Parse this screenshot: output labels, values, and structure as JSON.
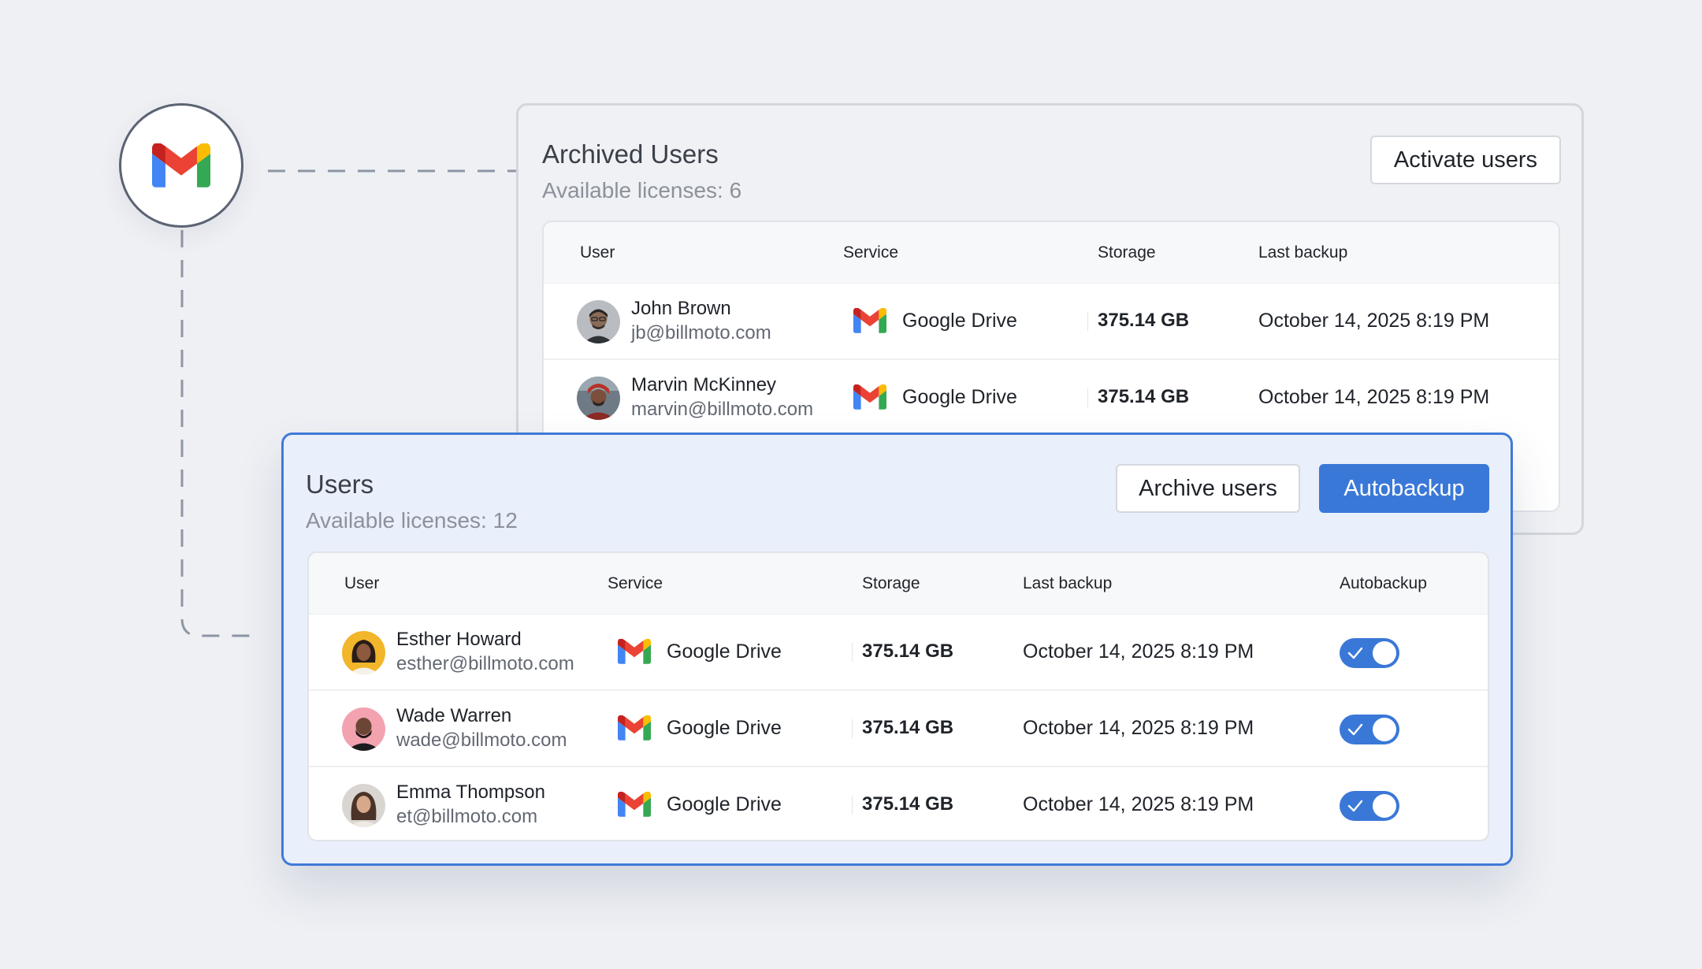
{
  "archived": {
    "title": "Archived Users",
    "licenses": "Available licenses: 6",
    "activate_label": "Activate users",
    "columns": [
      "User",
      "Service",
      "Storage",
      "Last backup"
    ],
    "rows": [
      {
        "name": "John Brown",
        "email": "jb@billmoto.com",
        "service": "Google Drive",
        "storage": "375.14 GB",
        "last_backup": "October 14, 2025 8:19 PM"
      },
      {
        "name": "Marvin McKinney",
        "email": "marvin@billmoto.com",
        "service": "Google Drive",
        "storage": "375.14 GB",
        "last_backup": "October 14, 2025 8:19 PM"
      }
    ]
  },
  "users": {
    "title": "Users",
    "licenses": "Available licenses: 12",
    "archive_label": "Archive users",
    "autobackup_label": "Autobackup",
    "columns": [
      "User",
      "Service",
      "Storage",
      "Last backup",
      "Autobackup"
    ],
    "rows": [
      {
        "name": "Esther Howard",
        "email": "esther@billmoto.com",
        "service": "Google Drive",
        "storage": "375.14 GB",
        "last_backup": "October 14, 2025 8:19 PM",
        "autobackup": true
      },
      {
        "name": "Wade Warren",
        "email": "wade@billmoto.com",
        "service": "Google Drive",
        "storage": "375.14 GB",
        "last_backup": "October 14, 2025 8:19 PM",
        "autobackup": true
      },
      {
        "name": "Emma Thompson",
        "email": "et@billmoto.com",
        "service": "Google Drive",
        "storage": "375.14 GB",
        "last_backup": "October 14, 2025 8:19 PM",
        "autobackup": true
      }
    ]
  },
  "icons": {
    "service_logo": "gmail-icon",
    "badge_logo": "gmail-icon",
    "toggle_check": "check-icon"
  },
  "colors": {
    "accent": "#3a78d8",
    "gmail_red": "#EA4335",
    "gmail_blue": "#4285F4",
    "gmail_green": "#34A853",
    "gmail_yellow": "#FBBC04",
    "gmail_darkred": "#C5221F"
  }
}
